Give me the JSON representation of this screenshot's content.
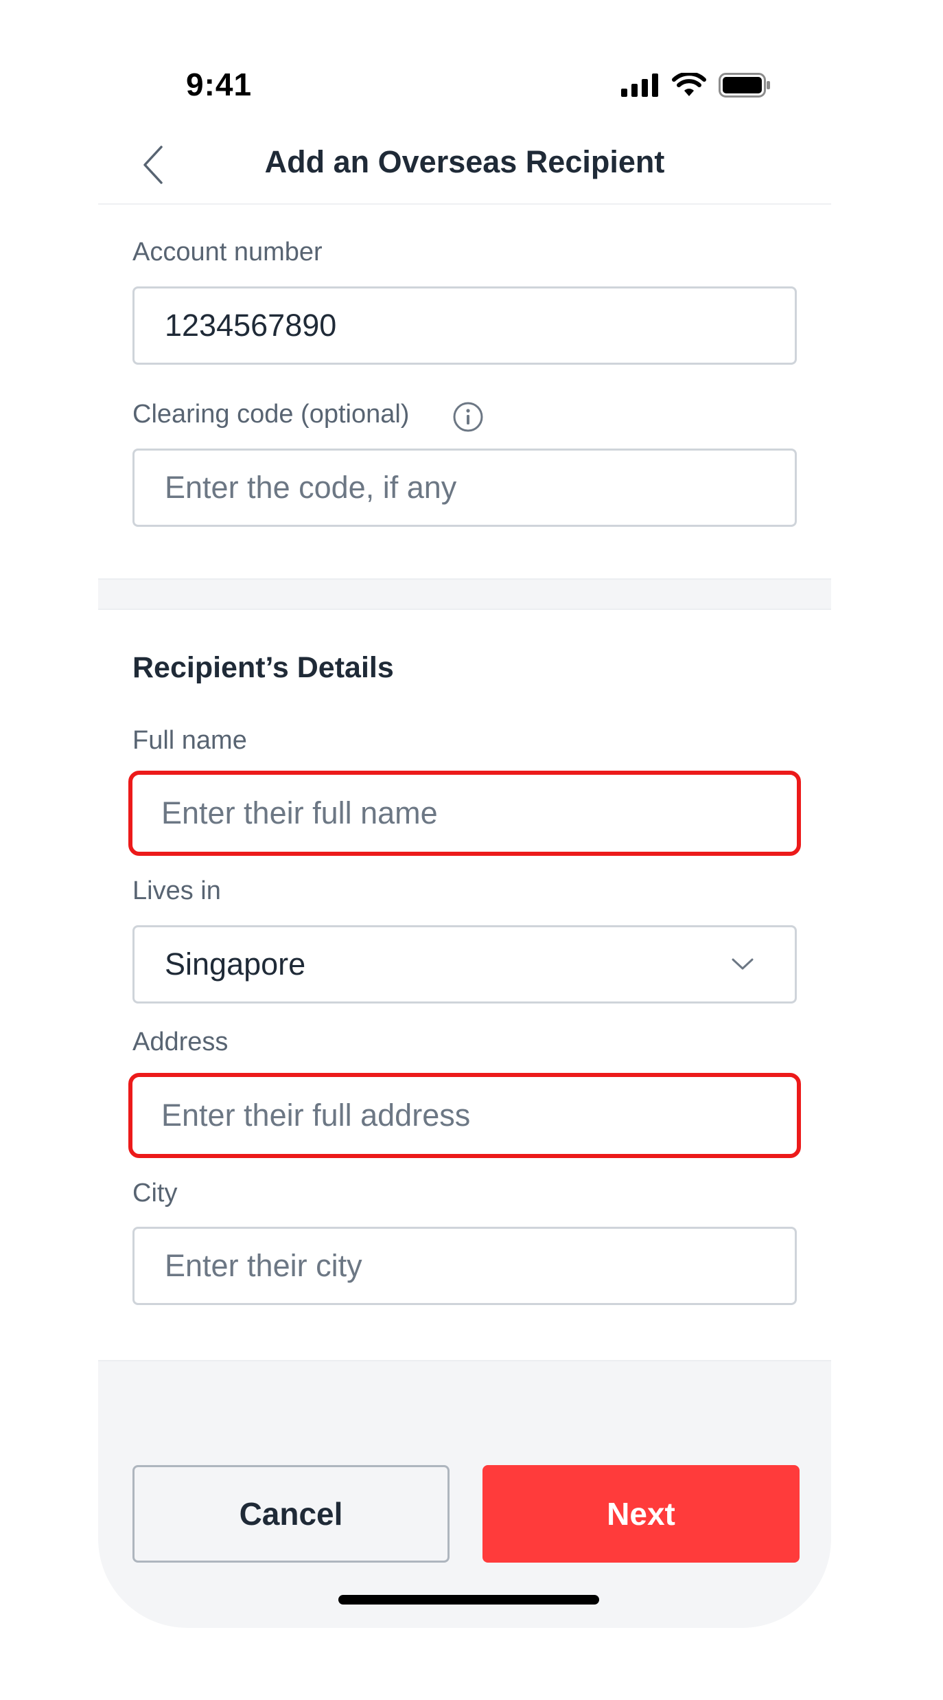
{
  "status_bar": {
    "time": "9:41",
    "icons": [
      "signal-icon",
      "wifi-icon",
      "battery-icon"
    ]
  },
  "header": {
    "title": "Add an Overseas Recipient",
    "back_icon": "chevron-left-icon"
  },
  "bank_details": {
    "account_number": {
      "label": "Account number",
      "value": "1234567890"
    },
    "clearing_code": {
      "label": "Clearing code (optional)",
      "placeholder": "Enter the code, if any",
      "value": "",
      "info_icon": "info-icon"
    }
  },
  "recipient": {
    "section_title": "Recipient’s Details",
    "full_name": {
      "label": "Full name",
      "placeholder": "Enter their full name",
      "value": "",
      "state": "error"
    },
    "lives_in": {
      "label": "Lives in",
      "selected": "Singapore",
      "icon": "chevron-down-icon"
    },
    "address": {
      "label": "Address",
      "placeholder": "Enter their full address",
      "value": "",
      "state": "error"
    },
    "city": {
      "label": "City",
      "placeholder": "Enter their city",
      "value": ""
    }
  },
  "actions": {
    "cancel_label": "Cancel",
    "next_label": "Next"
  },
  "colors": {
    "accent": "#ff3b3b",
    "error_border": "#ec1a1a",
    "text_primary": "#1f2a37",
    "text_secondary": "#586472",
    "placeholder": "#6c7784",
    "surface_muted": "#f4f5f7"
  }
}
